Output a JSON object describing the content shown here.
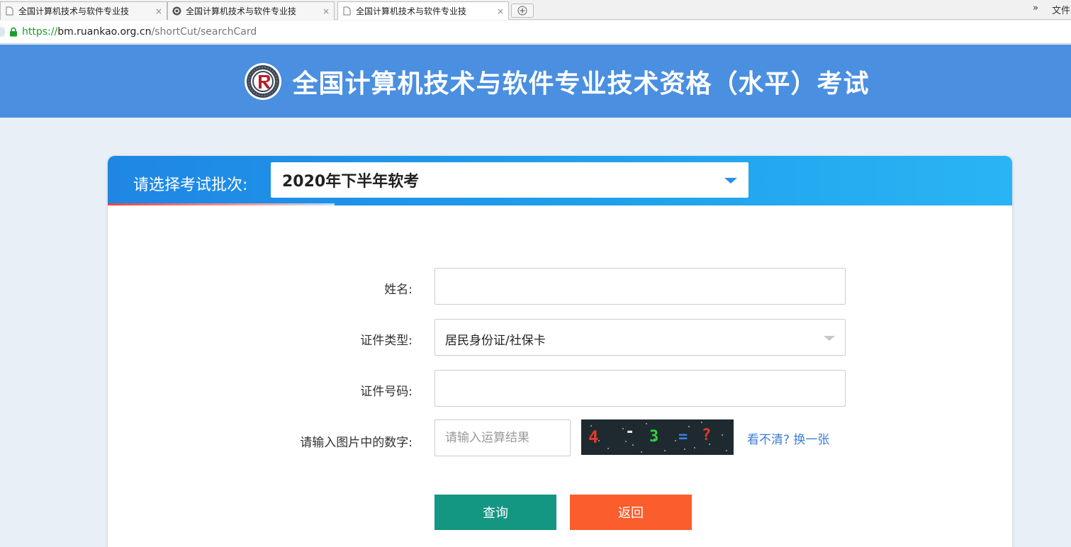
{
  "browser": {
    "tabs": [
      {
        "title": "全国计算机技术与软件专业技",
        "icon": "page-icon"
      },
      {
        "title": "全国计算机技术与软件专业技",
        "icon": "site-logo-icon"
      },
      {
        "title": "全国计算机技术与软件专业技",
        "icon": "page-icon",
        "active": true
      }
    ],
    "tab_close": "×",
    "new_tab_icon": "new-tab-icon",
    "overflow": "»",
    "overflow_label": "文件",
    "url": {
      "protocol": "https://",
      "host": "bm.ruankao.org.cn",
      "path": "/shortCut/searchCard"
    }
  },
  "banner": {
    "title": "全国计算机技术与软件专业技术资格（水平）考试",
    "background": "#4a8fe0"
  },
  "batch": {
    "label": "请选择考试批次:",
    "selected": "2020年下半年软考"
  },
  "form": {
    "name_label": "姓名:",
    "name_value": "",
    "id_type_label": "证件类型:",
    "id_type_selected": "居民身份证/社保卡",
    "id_number_label": "证件号码:",
    "id_number_value": "",
    "captcha_label": "请输入图片中的数字:",
    "captcha_placeholder": "请输入运算结果",
    "captcha_text": "4 - 3 = ?",
    "refresh_link": "看不清? 换一张"
  },
  "buttons": {
    "query": "查询",
    "back": "返回",
    "query_color": "#139682",
    "back_color": "#fb5d2c"
  }
}
